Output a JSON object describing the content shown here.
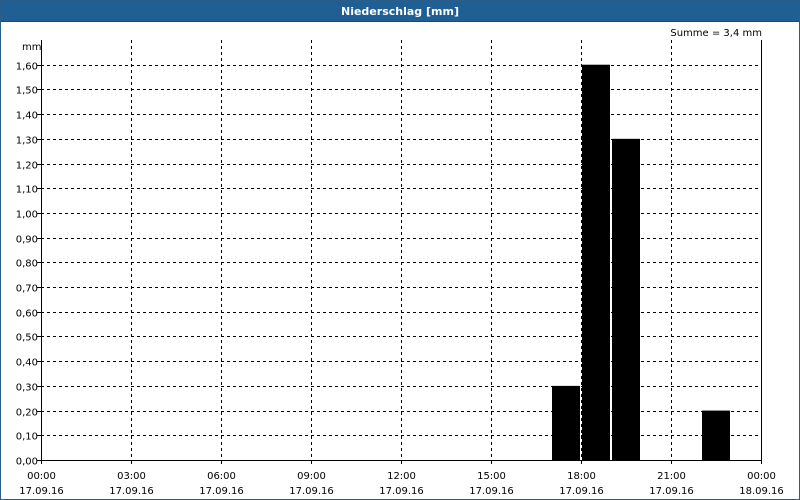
{
  "window": {
    "title": "Niederschlag [mm]"
  },
  "chart_data": {
    "type": "bar",
    "title": "Niederschlag [mm]",
    "unit_label": "mm",
    "annotation": "Summe = 3,4 mm",
    "ylim": [
      0,
      1.7
    ],
    "yticks": [
      "0,00",
      "0,10",
      "0,20",
      "0,30",
      "0,40",
      "0,50",
      "0,60",
      "0,70",
      "0,80",
      "0,90",
      "1,00",
      "1,10",
      "1,20",
      "1,30",
      "1,40",
      "1,50",
      "1,60"
    ],
    "xticks": [
      {
        "time": "00:00",
        "date": "17.09.16"
      },
      {
        "time": "03:00",
        "date": "17.09.16"
      },
      {
        "time": "06:00",
        "date": "17.09.16"
      },
      {
        "time": "09:00",
        "date": "17.09.16"
      },
      {
        "time": "12:00",
        "date": "17.09.16"
      },
      {
        "time": "15:00",
        "date": "17.09.16"
      },
      {
        "time": "18:00",
        "date": "17.09.16"
      },
      {
        "time": "21:00",
        "date": "17.09.16"
      },
      {
        "time": "00:00",
        "date": "18.09.16"
      }
    ],
    "x_range_hours": [
      0,
      24
    ],
    "bar_width_hours": 1,
    "bars": [
      {
        "start_hour": 17,
        "value": 0.3
      },
      {
        "start_hour": 18,
        "value": 1.6
      },
      {
        "start_hour": 19,
        "value": 1.3
      },
      {
        "start_hour": 22,
        "value": 0.2
      }
    ],
    "grid": true,
    "colors": {
      "bar": "#000000",
      "grid": "#000000",
      "title_bg": "#1f5f93"
    }
  }
}
